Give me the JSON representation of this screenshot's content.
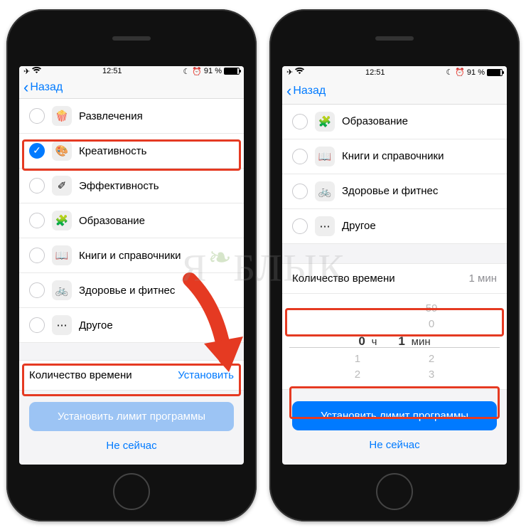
{
  "watermark": "ЯБЛЫК",
  "statusbar": {
    "time": "12:51",
    "battery_pct": "91 %"
  },
  "nav": {
    "back": "Назад"
  },
  "left": {
    "categories": [
      {
        "label": "Развлечения",
        "checked": false,
        "glyph": "🍿",
        "bg": "#fff"
      },
      {
        "label": "Креативность",
        "checked": true,
        "glyph": "🎨",
        "bg": "#fff"
      },
      {
        "label": "Эффективность",
        "checked": false,
        "glyph": "✐",
        "bg": "#fff"
      },
      {
        "label": "Образование",
        "checked": false,
        "glyph": "🧩",
        "bg": "#fff"
      },
      {
        "label": "Книги и справочники",
        "checked": false,
        "glyph": "📖",
        "bg": "#fff"
      },
      {
        "label": "Здоровье и фитнес",
        "checked": false,
        "glyph": "🚲",
        "bg": "#fff"
      },
      {
        "label": "Другое",
        "checked": false,
        "glyph": "⋯",
        "bg": "#fff"
      }
    ],
    "time_label": "Количество времени",
    "time_action": "Установить",
    "primary": "Установить лимит программы",
    "secondary": "Не сейчас"
  },
  "right": {
    "categories": [
      {
        "label": "Образование",
        "checked": false,
        "glyph": "🧩",
        "bg": "#fff"
      },
      {
        "label": "Книги и справочники",
        "checked": false,
        "glyph": "📖",
        "bg": "#fff"
      },
      {
        "label": "Здоровье и фитнес",
        "checked": false,
        "glyph": "🚲",
        "bg": "#fff"
      },
      {
        "label": "Другое",
        "checked": false,
        "glyph": "⋯",
        "bg": "#fff"
      }
    ],
    "time_label": "Количество времени",
    "time_value": "1 мин",
    "picker": {
      "hours": "0",
      "hours_unit": "ч",
      "mins": "1",
      "mins_unit": "мин",
      "prev_h": "",
      "next_h": "1",
      "next_h2": "2",
      "prev_m": "59",
      "prev_m2": "0",
      "next_m": "2",
      "next_m2": "3"
    },
    "primary": "Установить лимит программы",
    "secondary": "Не сейчас"
  }
}
